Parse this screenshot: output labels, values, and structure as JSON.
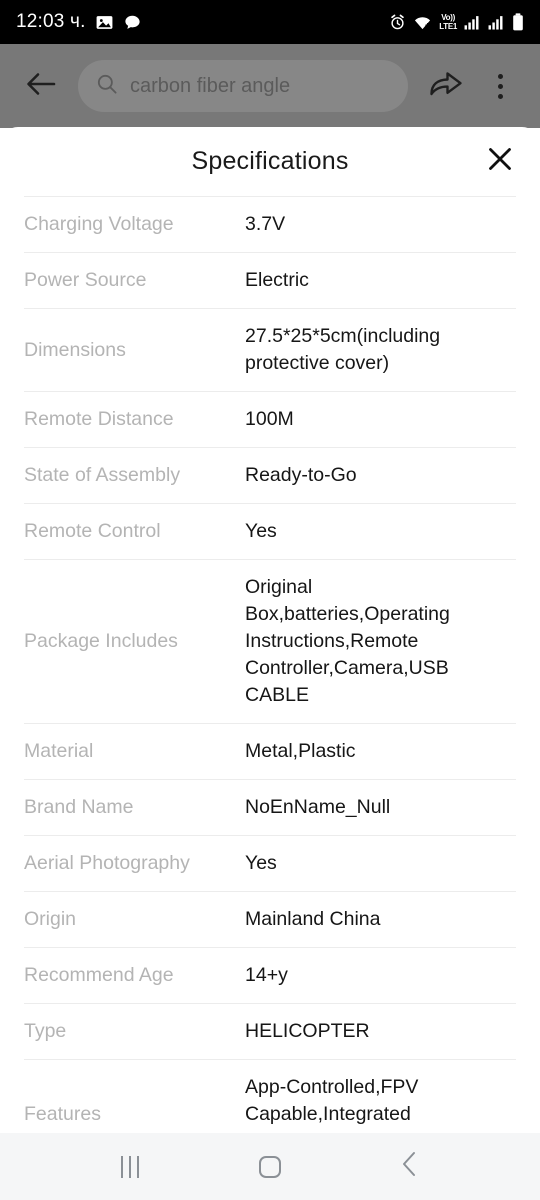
{
  "status_bar": {
    "time": "12:03 ч.",
    "left_icons": [
      "photo-icon",
      "chat-bubble-icon"
    ],
    "right_icons": [
      "alarm-icon",
      "wifi-icon",
      "volte-icon",
      "signal-1-icon",
      "signal-2-icon",
      "battery-icon"
    ],
    "volte_top": "Vo))",
    "volte_bottom": "LTE1",
    "background_color": "#000000"
  },
  "toolbar": {
    "back_label": "back-arrow",
    "search_value": "carbon fiber angle",
    "search_placeholder": "Search",
    "share_label": "share",
    "more_label": "more options",
    "background_color": "#787878"
  },
  "sheet": {
    "title": "Specifications",
    "close_label": "Close",
    "specs": [
      {
        "label": "Charging Voltage",
        "value": "3.7V"
      },
      {
        "label": "Power Source",
        "value": "Electric"
      },
      {
        "label": "Dimensions",
        "value": "27.5*25*5cm(including protective cover)"
      },
      {
        "label": "Remote Distance",
        "value": "100M"
      },
      {
        "label": "State of Assembly",
        "value": "Ready-to-Go"
      },
      {
        "label": "Remote Control",
        "value": "Yes"
      },
      {
        "label": "Package Includes",
        "value": "Original Box,batteries,Operating Instructions,Remote Controller,Camera,USB CABLE"
      },
      {
        "label": "Material",
        "value": "Metal,Plastic"
      },
      {
        "label": "Brand Name",
        "value": "NoEnName_Null"
      },
      {
        "label": "Aerial Photography",
        "value": "Yes"
      },
      {
        "label": "Origin",
        "value": "Mainland China"
      },
      {
        "label": "Recommend Age",
        "value": "14+y"
      },
      {
        "label": "Type",
        "value": "HELICOPTER"
      },
      {
        "label": "Features",
        "value": "App-Controlled,FPV Capable,Integrated Camera,WI-FI,other"
      }
    ]
  },
  "nav_bar": {
    "recents_label": "Recents",
    "home_label": "Home",
    "back_label": "Back",
    "background_color": "#f5f6f7"
  }
}
